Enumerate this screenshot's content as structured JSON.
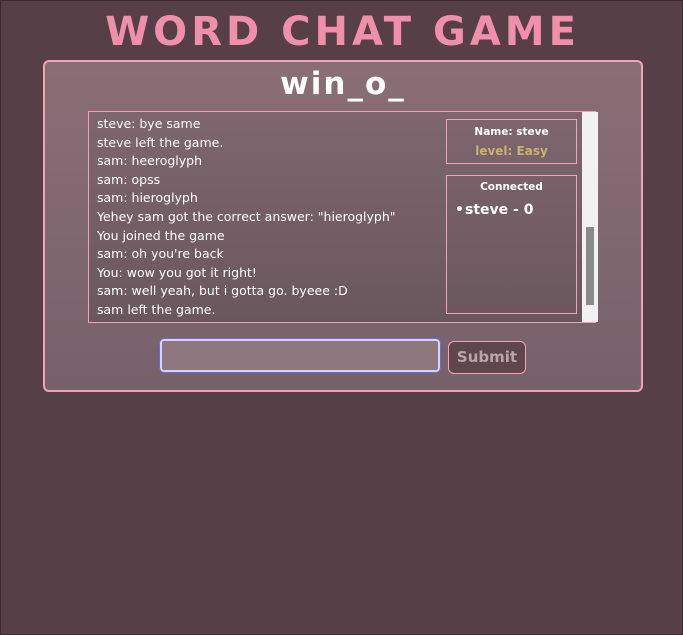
{
  "app": {
    "title": "WORD CHAT GAME"
  },
  "game": {
    "word_hint": "win_o_"
  },
  "chat": {
    "messages": [
      "steve: bye same",
      "steve left the game.",
      "sam: heeroglyph",
      "sam: opss",
      "sam: hieroglyph",
      "Yehey sam got the correct answer: \"hieroglyph\"",
      "You joined the game",
      "sam: oh you're back",
      "You: wow you got it right!",
      "sam: well yeah, but i gotta go. byeee :D",
      "sam left the game."
    ]
  },
  "player_info": {
    "name": "Name: steve",
    "level": "level: Easy"
  },
  "connected": {
    "title": "Connected",
    "players": [
      "steve - 0"
    ]
  },
  "input": {
    "value": "",
    "placeholder": ""
  },
  "submit": {
    "label": "Submit"
  },
  "colors": {
    "background": "#563f46",
    "accent": "#f08fab",
    "border": "#f2a3ba",
    "level": "#c8b36f"
  }
}
